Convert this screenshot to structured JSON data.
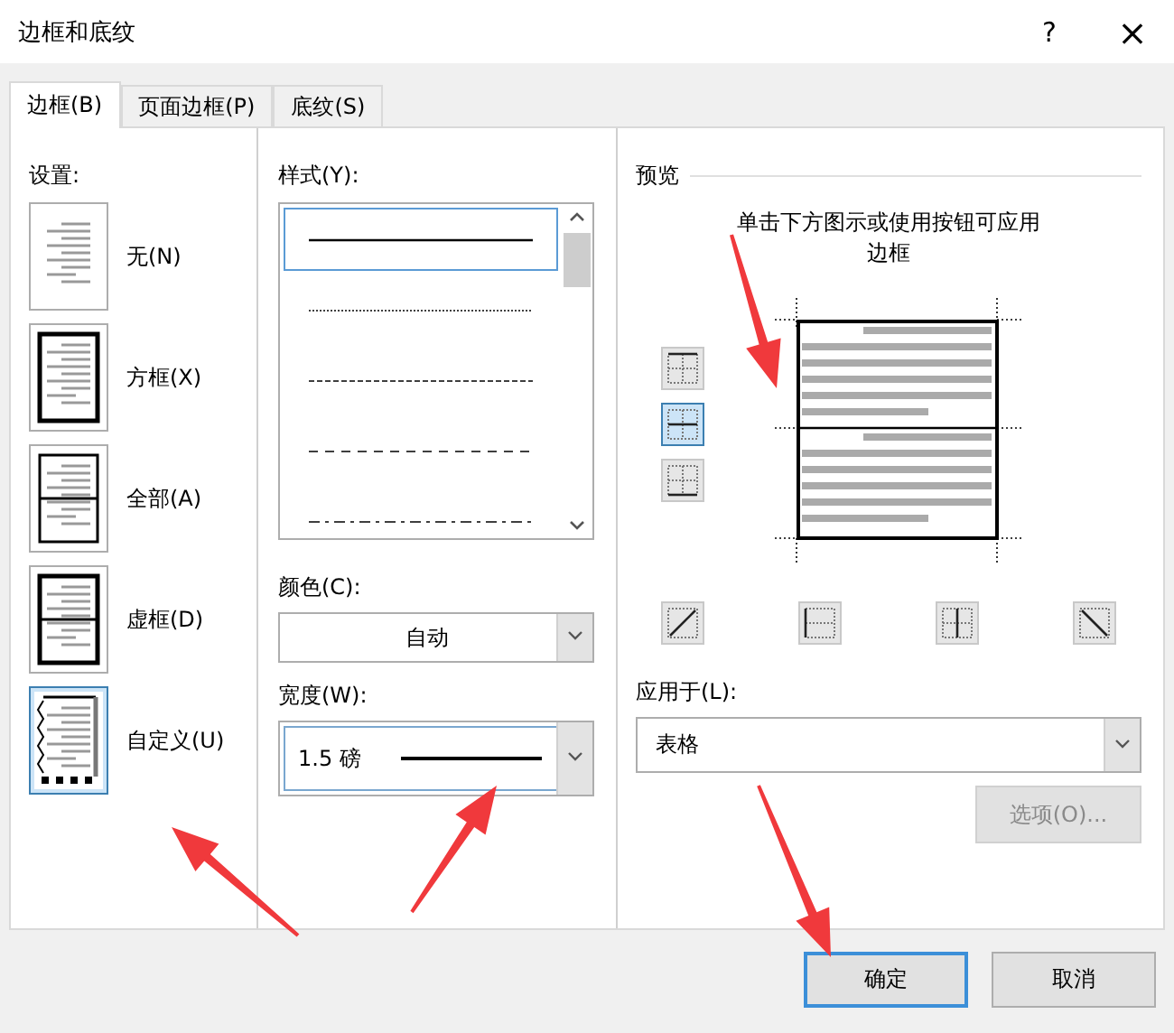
{
  "window": {
    "title": "边框和底纹",
    "help": "?",
    "close": "×"
  },
  "tabs": [
    {
      "label": "边框(B)",
      "selected": true
    },
    {
      "label": "页面边框(P)",
      "selected": false
    },
    {
      "label": "底纹(S)",
      "selected": false
    }
  ],
  "settings": {
    "label": "设置:",
    "items": [
      {
        "label": "无(N)",
        "kind": "none",
        "selected": false
      },
      {
        "label": "方框(X)",
        "kind": "box",
        "selected": false
      },
      {
        "label": "全部(A)",
        "kind": "all",
        "selected": false
      },
      {
        "label": "虚框(D)",
        "kind": "grid",
        "selected": false
      },
      {
        "label": "自定义(U)",
        "kind": "custom",
        "selected": true
      }
    ]
  },
  "style": {
    "label": "样式(Y):",
    "items": [
      {
        "kind": "solid",
        "selected": true
      },
      {
        "kind": "dotted",
        "selected": false
      },
      {
        "kind": "dashed",
        "selected": false
      },
      {
        "kind": "long-dash",
        "selected": false
      },
      {
        "kind": "dash-dot",
        "selected": false
      }
    ]
  },
  "color": {
    "label": "颜色(C):",
    "value": "自动"
  },
  "width": {
    "label": "宽度(W):",
    "value": "1.5 磅"
  },
  "preview": {
    "label": "预览",
    "hint": "单击下方图示或使用按钮可应用边框",
    "side_buttons": [
      {
        "kind": "top",
        "on": false
      },
      {
        "kind": "middle",
        "on": true
      },
      {
        "kind": "bottom",
        "on": false
      }
    ],
    "bottom_buttons": [
      {
        "kind": "diag-up",
        "on": false
      },
      {
        "kind": "left",
        "on": false
      },
      {
        "kind": "center",
        "on": false
      },
      {
        "kind": "diag-down",
        "on": false
      }
    ]
  },
  "apply_to": {
    "label": "应用于(L):",
    "value": "表格"
  },
  "options_button": {
    "label": "选项(O)...",
    "disabled": true
  },
  "buttons": [
    {
      "label": "确定",
      "kind": "default"
    },
    {
      "label": "取消",
      "kind": "normal"
    }
  ]
}
